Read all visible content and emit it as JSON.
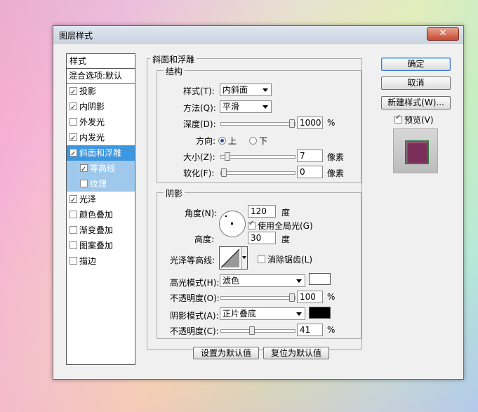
{
  "window": {
    "title": "图层样式"
  },
  "style_list": {
    "header": "样式",
    "blend_options": "混合选项:默认",
    "items": [
      {
        "label": "投影",
        "checked": true
      },
      {
        "label": "内阴影",
        "checked": true
      },
      {
        "label": "外发光",
        "checked": false
      },
      {
        "label": "内发光",
        "checked": true
      },
      {
        "label": "斜面和浮雕",
        "checked": true,
        "selected": true
      },
      {
        "label": "等高线",
        "checked": true,
        "sub": true
      },
      {
        "label": "纹理",
        "checked": false,
        "sub": true
      },
      {
        "label": "光泽",
        "checked": true
      },
      {
        "label": "颜色叠加",
        "checked": false
      },
      {
        "label": "渐变叠加",
        "checked": false
      },
      {
        "label": "图案叠加",
        "checked": false
      },
      {
        "label": "描边",
        "checked": false
      }
    ]
  },
  "bevel": {
    "group_title": "斜面和浮雕",
    "structure_title": "结构",
    "style_label": "样式(T):",
    "style_value": "内斜面",
    "technique_label": "方法(Q):",
    "technique_value": "平滑",
    "depth_label": "深度(D):",
    "depth_value": "1000",
    "depth_unit": "%",
    "depth_fraction": 1.0,
    "direction_label": "方向:",
    "direction_up": "上",
    "direction_down": "下",
    "direction_selected": "上",
    "size_label": "大小(Z):",
    "size_value": "7",
    "size_unit": "像素",
    "size_fraction": 0.05,
    "soften_label": "软化(F):",
    "soften_value": "0",
    "soften_unit": "像素",
    "soften_fraction": 0.0
  },
  "shading": {
    "title": "阴影",
    "angle_label": "角度(N):",
    "angle_value": "120",
    "angle_unit": "度",
    "global_light_label": "使用全局光(G)",
    "global_light_checked": true,
    "altitude_label": "高度:",
    "altitude_value": "30",
    "altitude_unit": "度",
    "gloss_contour_label": "光泽等高线:",
    "anti_aliased_label": "消除锯齿(L)",
    "anti_aliased_checked": false,
    "highlight_mode_label": "高光模式(H):",
    "highlight_mode_value": "滤色",
    "highlight_color": "#ffffff",
    "highlight_opacity_label": "不透明度(O):",
    "highlight_opacity_value": "100",
    "highlight_opacity_unit": "%",
    "highlight_opacity_fraction": 1.0,
    "shadow_mode_label": "阴影模式(A):",
    "shadow_mode_value": "正片叠底",
    "shadow_color": "#000000",
    "shadow_opacity_label": "不透明度(C):",
    "shadow_opacity_value": "41",
    "shadow_opacity_unit": "%",
    "shadow_opacity_fraction": 0.41
  },
  "buttons": {
    "make_default": "设置为默认值",
    "reset_default": "复位为默认值",
    "ok": "确定",
    "cancel": "取消",
    "new_style": "新建样式(W)...",
    "preview_label": "预览(V)",
    "preview_checked": true
  },
  "colors": {
    "selected": "#3d96e0",
    "sub_selected": "#9ec8ec",
    "preview_fill": "#7a2e5a"
  }
}
